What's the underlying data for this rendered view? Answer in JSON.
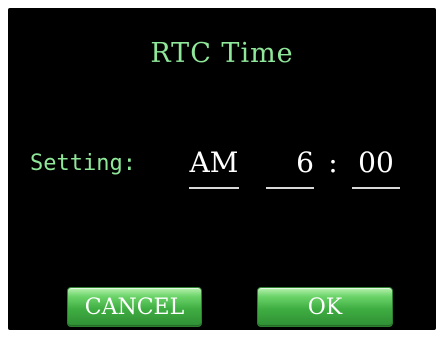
{
  "screen": {
    "title": "RTC Time",
    "setting_label": "Setting:",
    "ampm_value": "AM",
    "hour_value": "6",
    "separator": ":",
    "minute_value": "00"
  },
  "buttons": {
    "cancel_label": "CANCEL",
    "ok_label": "OK"
  },
  "colors": {
    "background": "#000000",
    "label_green": "#8fe79a",
    "button_green": "#3fae42",
    "value_text": "#ffffff"
  }
}
